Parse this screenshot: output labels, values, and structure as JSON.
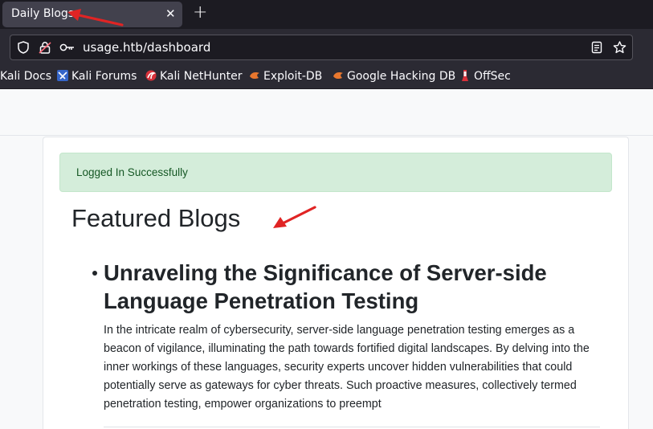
{
  "browser": {
    "tab_title": "Daily Blogs",
    "tab_close": "✕",
    "new_tab": "+",
    "url": "usage.htb/dashboard"
  },
  "bookmarks": [
    {
      "label": "Kali Docs",
      "icon": "kali-docs-icon"
    },
    {
      "label": "Kali Forums",
      "icon": "kali-forums-icon"
    },
    {
      "label": "Kali NetHunter",
      "icon": "kali-nethunter-icon"
    },
    {
      "label": "Exploit-DB",
      "icon": "exploit-db-icon"
    },
    {
      "label": "Google Hacking DB",
      "icon": "google-hacking-db-icon"
    },
    {
      "label": "OffSec",
      "icon": "offsec-icon"
    }
  ],
  "alert": {
    "message": "Logged In Successfully",
    "color": "#155724",
    "background": "#d4edda"
  },
  "main": {
    "title": "Featured Blogs",
    "posts": [
      {
        "title": "Unraveling the Significance of Server-side Language Penetration Testing",
        "body": "In the intricate realm of cybersecurity, server-side language penetration testing emerges as a beacon of vigilance, illuminating the path towards fortified digital landscapes. By delving into the inner workings of these languages, security experts uncover hidden vulnerabilities that could potentially serve as gateways for cyber threats. Such proactive measures, collectively termed penetration testing, empower organizations to preempt"
      }
    ]
  },
  "annotations": {
    "arrow_color": "#e02424"
  }
}
